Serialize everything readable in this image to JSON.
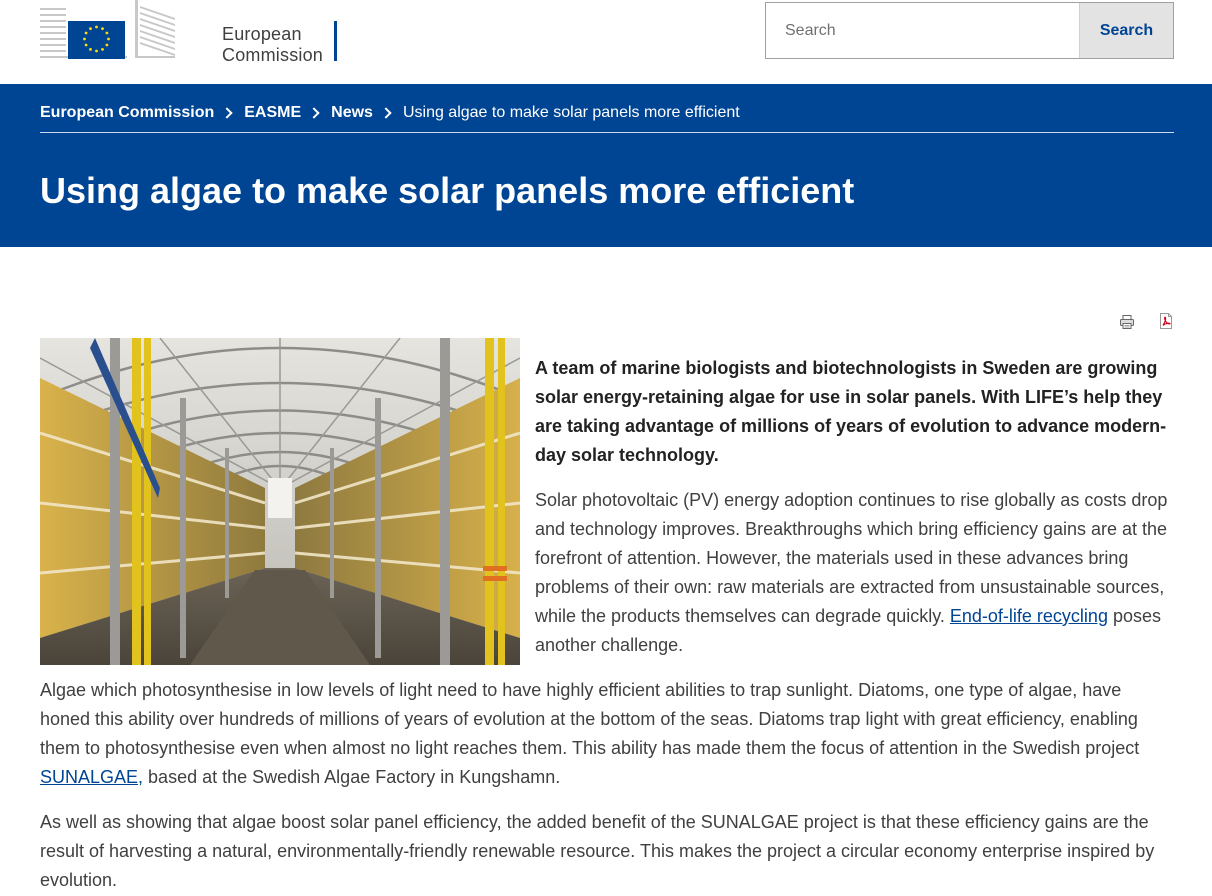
{
  "header": {
    "logo_line1": "European",
    "logo_line2": "Commission",
    "search": {
      "placeholder": "Search",
      "button_label": "Search"
    }
  },
  "breadcrumb": [
    {
      "label": "European Commission"
    },
    {
      "label": "EASME"
    },
    {
      "label": "News"
    },
    {
      "label": "Using algae to make solar panels more efficient"
    }
  ],
  "page": {
    "title": "Using algae to make solar panels more efficient"
  },
  "tools": {
    "print_icon": "printer-icon",
    "pdf_icon": "pdf-icon"
  },
  "article": {
    "lead": "A team of marine biologists and biotechnologists in Sweden are growing solar energy-retaining algae for use in solar panels. With LIFE’s help they are taking advantage of millions of years of evolution to advance modern-day solar technology.",
    "p1_before": "Solar photovoltaic (PV) energy adoption continues to rise globally as costs drop and technology improves. Breakthroughs which bring efficiency gains are at the forefront of attention. However, the materials used in these advances bring problems of their own: raw materials are extracted from unsustainable sources, while the products themselves can degrade quickly. ",
    "p1_link": "End-of-life recycling",
    "p1_after": " poses another challenge.",
    "p2_before": "Algae which photosynthesise in low levels of light need to have highly efficient abilities to trap sunlight. Diatoms, one type of algae, have honed this ability over hundreds of millions of years of evolution at the bottom of the seas. Diatoms trap light with great efficiency, enabling them to photosynthesise even when almost no light reaches them. This ability has made them the focus of attention in the Swedish project ",
    "p2_link": "SUNALGAE,",
    "p2_after": " based at the Swedish Algae Factory in Kungshamn.",
    "p3": "As well as showing that algae boost solar panel efficiency, the added benefit of the SUNALGAE project is that these efficiency gains are the result of harvesting a natural, environmentally-friendly renewable resource. This makes the project a circular economy enterprise inspired by evolution."
  },
  "colors": {
    "brand_blue": "#004494",
    "text": "#404040"
  }
}
